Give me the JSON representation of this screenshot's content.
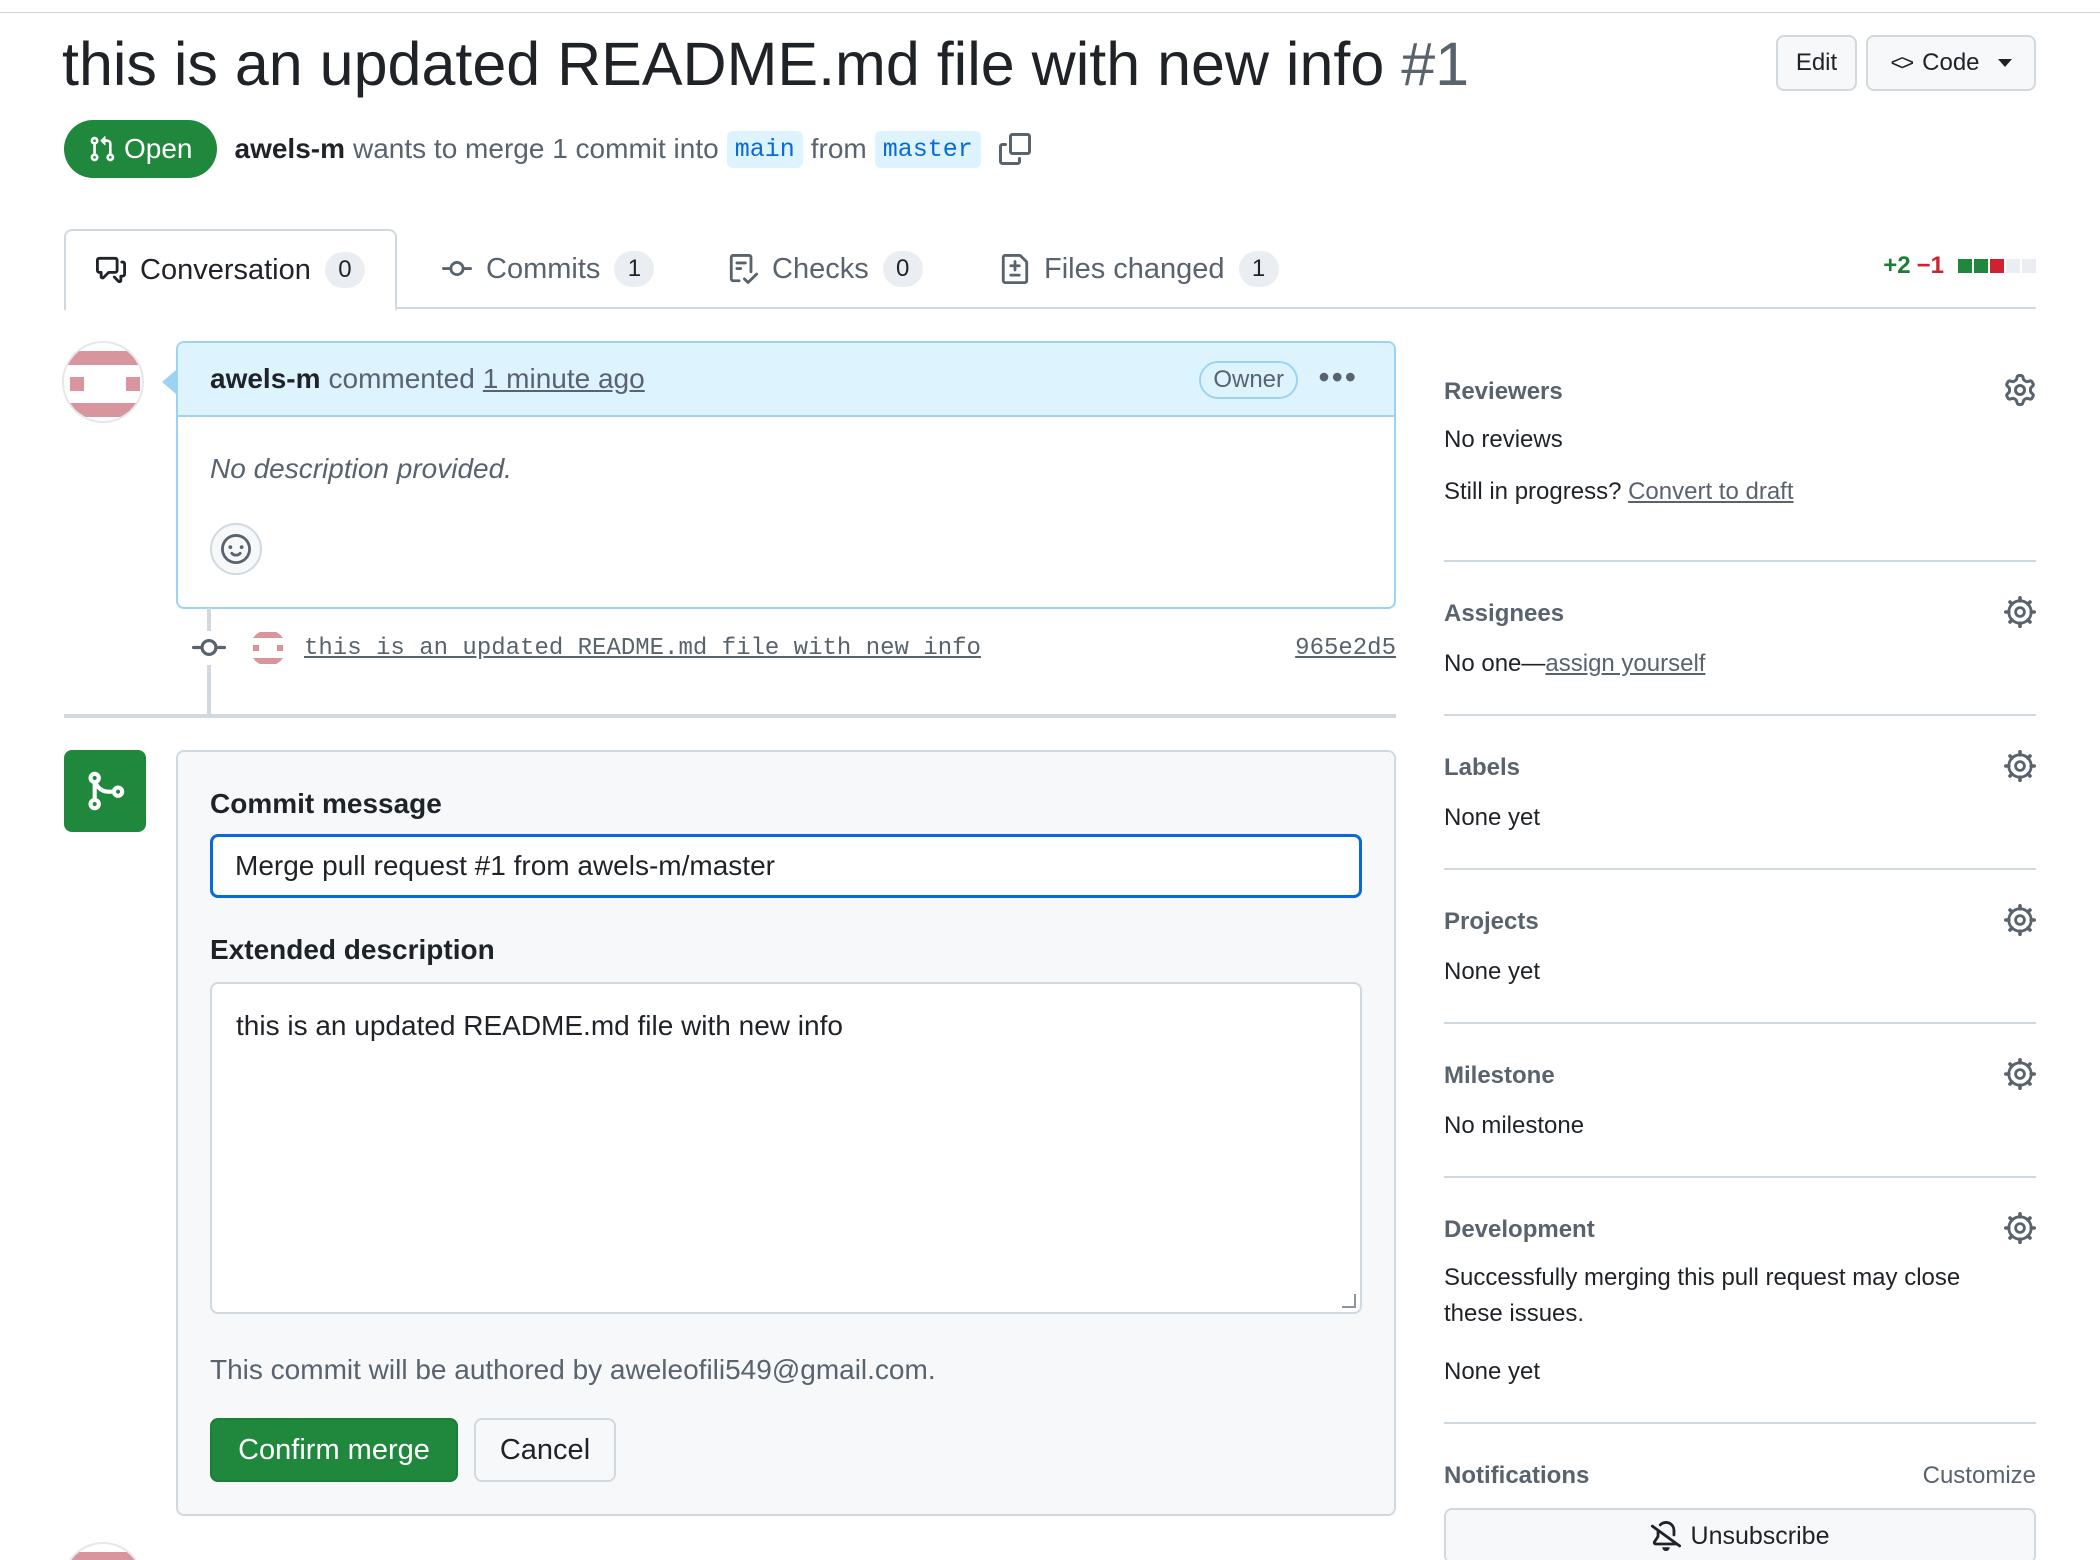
{
  "pr": {
    "title": "this is an updated README.md file with new info",
    "number": "#1",
    "state": "Open",
    "author": "awels-m",
    "merge_text": "wants to merge 1 commit into",
    "base_branch": "main",
    "from_text": "from",
    "head_branch": "master"
  },
  "header_actions": {
    "edit": "Edit",
    "code": "Code"
  },
  "tabs": [
    {
      "label": "Conversation",
      "count": "0"
    },
    {
      "label": "Commits",
      "count": "1"
    },
    {
      "label": "Checks",
      "count": "0"
    },
    {
      "label": "Files changed",
      "count": "1"
    }
  ],
  "diffstat": {
    "additions": "+2",
    "deletions": "−1"
  },
  "comment": {
    "author": "awels-m",
    "action": "commented",
    "time": "1 minute ago",
    "badge": "Owner",
    "body": "No description provided."
  },
  "commit": {
    "message": "this is an updated README.md file with new info",
    "sha": "965e2d5"
  },
  "merge_form": {
    "commit_label": "Commit message",
    "commit_value": "Merge pull request #1 from awels-m/master",
    "ext_label": "Extended description",
    "ext_value": "this is an updated README.md file with new info",
    "author_note": "This commit will be authored by aweleofili549@gmail.com.",
    "confirm": "Confirm merge",
    "cancel": "Cancel"
  },
  "sidebar": {
    "reviewers": {
      "title": "Reviewers",
      "value": "No reviews",
      "draft_prefix": "Still in progress?",
      "draft_link": "Convert to draft"
    },
    "assignees": {
      "title": "Assignees",
      "prefix": "No one—",
      "link": "assign yourself"
    },
    "labels": {
      "title": "Labels",
      "value": "None yet"
    },
    "projects": {
      "title": "Projects",
      "value": "None yet"
    },
    "milestone": {
      "title": "Milestone",
      "value": "No milestone"
    },
    "development": {
      "title": "Development",
      "desc": "Successfully merging this pull request may close these issues.",
      "value": "None yet"
    },
    "notifications": {
      "title": "Notifications",
      "customize": "Customize",
      "unsubscribe": "Unsubscribe"
    }
  },
  "colors": {
    "success": "#1f883d",
    "accent": "#0969da",
    "danger": "#cf222e",
    "muted": "#59636e",
    "border": "#d1d9e0"
  },
  "icons": [
    "git-pull-request-icon",
    "copy-icon",
    "comment-discussion-icon",
    "git-commit-icon",
    "checklist-icon",
    "file-diff-icon",
    "kebab-horizontal-icon",
    "smiley-icon",
    "git-merge-icon",
    "gear-icon",
    "bell-slash-icon",
    "code-icon"
  ]
}
